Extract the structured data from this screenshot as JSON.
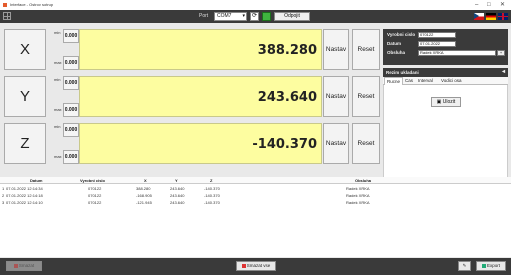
{
  "window": {
    "title": "Interface - Ostrov sotrup",
    "controls": [
      "–",
      "□",
      "✕"
    ]
  },
  "toolbar": {
    "port_label": "Port",
    "port_value": "COM7",
    "connect_label": "Odpojit",
    "languages": [
      "cs",
      "de",
      "en"
    ],
    "colors": {
      "dark": "#3a3a3a",
      "connected": "#3fb43f",
      "display": "#fdfda0"
    }
  },
  "axes": [
    {
      "name": "X",
      "min_label": "min",
      "min_value": "0.000",
      "max_label": "max",
      "max_value": "0.000",
      "value": "388.280",
      "set_label": "Nastav",
      "reset_label": "Reset"
    },
    {
      "name": "Y",
      "min_label": "min",
      "min_value": "0.000",
      "max_label": "max",
      "max_value": "0.000",
      "value": "243.640",
      "set_label": "Nastav",
      "reset_label": "Reset"
    },
    {
      "name": "Z",
      "min_label": "min",
      "min_value": "0.000",
      "max_label": "max",
      "max_value": "0.000",
      "value": "-140.370",
      "set_label": "Nastav",
      "reset_label": "Reset"
    }
  ],
  "info": {
    "serial_label": "Vyrobni cislo",
    "serial_value": "070122",
    "date_label": "Datum",
    "date_value": "07.01.2022",
    "operator_label": "Obsluha",
    "operator_value": "Radek XRKA"
  },
  "mode": {
    "title": "Rezim ukladani",
    "tabs": [
      "Rucne",
      "Cas",
      "Interval",
      "Vodici osa"
    ],
    "active_tab": "Rucne",
    "save_label": "Ulozit"
  },
  "table": {
    "columns": [
      "Datum",
      "Vyrobni cislo",
      "X",
      "Y",
      "Z",
      "Obsluha"
    ],
    "rows": [
      {
        "n": "1",
        "datum": "07.01.2022 12:14:34",
        "serial": "070122",
        "x": "388.280",
        "y": "243.640",
        "z": "-140.370",
        "operator": "Radek XRKA"
      },
      {
        "n": "2",
        "datum": "07.01.2022 12:14:18",
        "serial": "070122",
        "x": "-168.905",
        "y": "243.640",
        "z": "-140.370",
        "operator": "Radek XRKA"
      },
      {
        "n": "3",
        "datum": "07.01.2022 12:14:10",
        "serial": "070122",
        "x": "-121.945",
        "y": "243.640",
        "z": "-140.370",
        "operator": "Radek XRKA"
      }
    ]
  },
  "bottom": {
    "delete_label": "Smazat",
    "delete_all_label": "Smazat vse",
    "export_label": "Export"
  }
}
